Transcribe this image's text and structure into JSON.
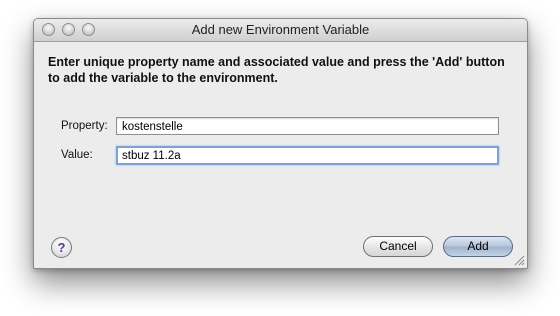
{
  "window": {
    "title": "Add new Environment Variable"
  },
  "instructions": "Enter unique property name and associated value and press the 'Add' button to add the variable to the environment.",
  "form": {
    "property_label": "Property:",
    "property_value": "kostenstelle",
    "value_label": "Value:",
    "value_value": "stbuz 11.2a"
  },
  "buttons": {
    "help_label": "?",
    "cancel_label": "Cancel",
    "add_label": "Add"
  },
  "icons": {
    "close": "close-button-icon",
    "minimize": "minimize-button-icon",
    "zoom": "zoom-button-icon",
    "help": "help-icon",
    "resize": "resize-grip-icon"
  }
}
